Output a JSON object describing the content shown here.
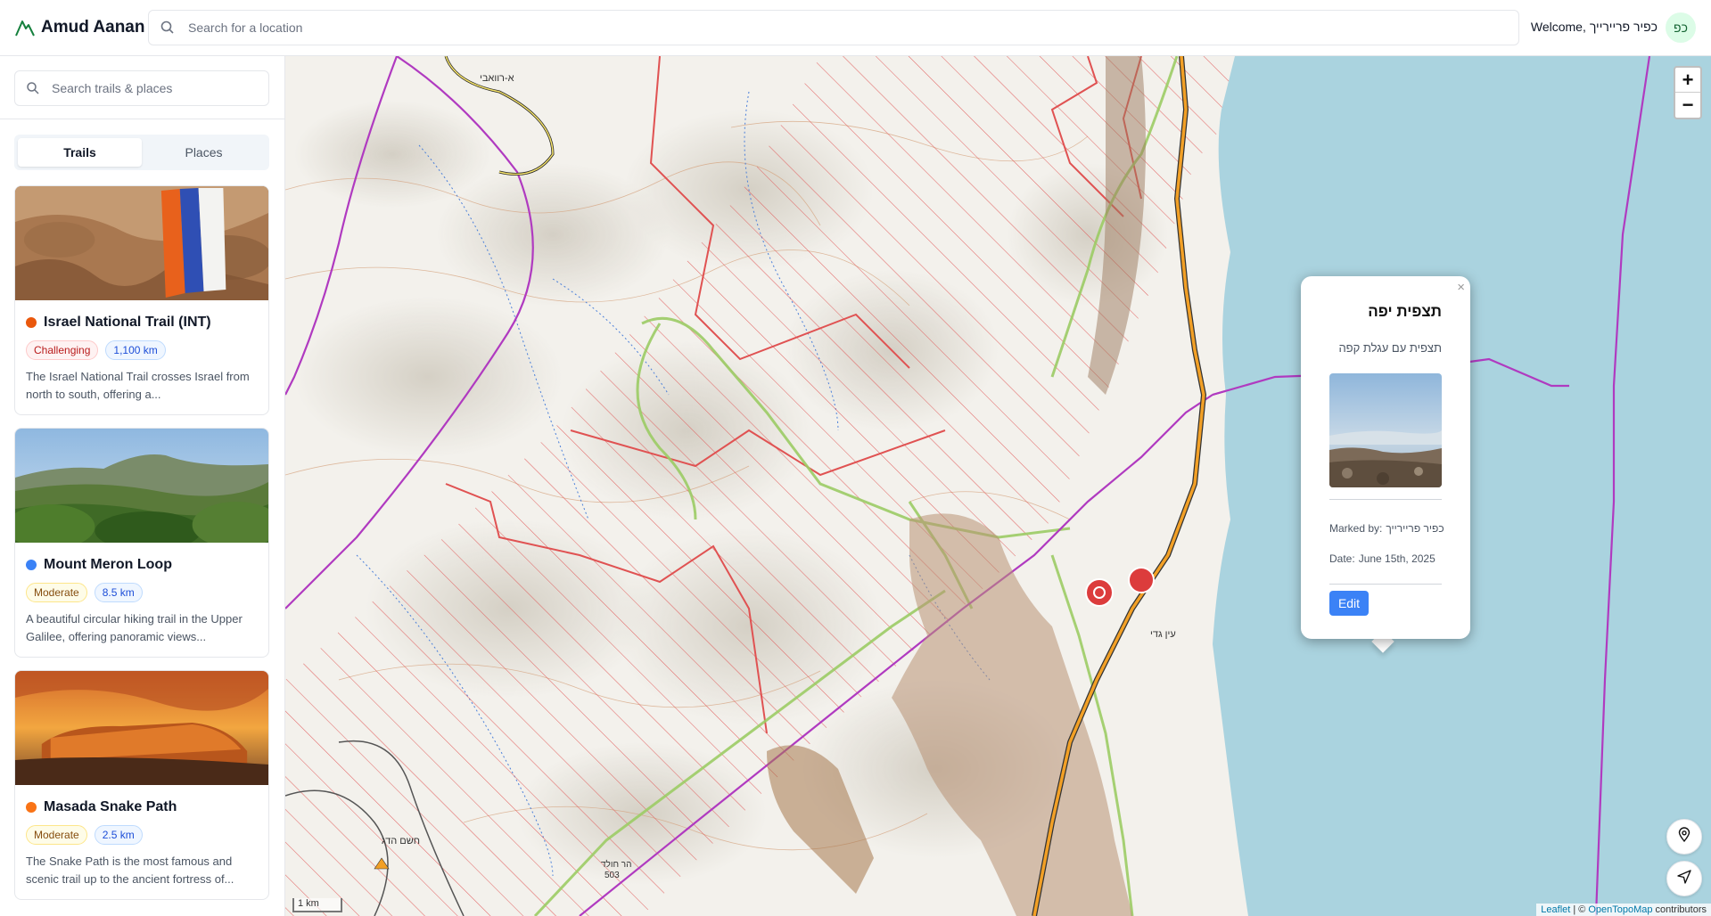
{
  "header": {
    "app_title": "Amud Aanan",
    "location_search_placeholder": "Search for a location",
    "welcome_prefix": "Welcome,",
    "user_name": "כפיר פריירייך",
    "avatar_initials": "כפ"
  },
  "sidebar": {
    "search_placeholder": "Search trails & places",
    "tabs": [
      {
        "label": "Trails",
        "active": true
      },
      {
        "label": "Places",
        "active": false
      }
    ],
    "trails": [
      {
        "title": "Israel National Trail (INT)",
        "dot_color": "#ea580c",
        "difficulty": "Challenging",
        "distance": "1,100 km",
        "description": "The Israel National Trail crosses Israel from north to south, offering a..."
      },
      {
        "title": "Mount Meron Loop",
        "dot_color": "#3b82f6",
        "difficulty": "Moderate",
        "distance": "8.5 km",
        "description": "A beautiful circular hiking trail in the Upper Galilee, offering panoramic views..."
      },
      {
        "title": "Masada Snake Path",
        "dot_color": "#f97316",
        "difficulty": "Moderate",
        "distance": "2.5 km",
        "description": "The Snake Path is the most famous and scenic trail up to the ancient fortress of..."
      }
    ]
  },
  "map": {
    "zoom_in_label": "+",
    "zoom_out_label": "−",
    "scale_label": "1 km",
    "attribution": {
      "leaflet": "Leaflet",
      "separator": "| ©",
      "opentopomap": "OpenTopoMap",
      "suffix": "contributors"
    },
    "labels": {
      "road_label_1": "א-רוואבי",
      "place_label_1": "עין גדי",
      "place_label_2": "חשם הדג",
      "peak_label": "הר חולד",
      "peak_elevation": "503"
    },
    "popup": {
      "title": "תצפית יפה",
      "subtitle": "תצפית עם עגלת קפה",
      "marked_by_label": "Marked by:",
      "marked_by_value": "כפיר פריירייך",
      "date_label": "Date:",
      "date_value": "June 15th, 2025",
      "edit_label": "Edit",
      "close_label": "×"
    },
    "colors": {
      "sea": "#aad3df",
      "restricted_hatch": "#e05252",
      "trail_green": "#9ccc65",
      "border_purple": "#b03ac0",
      "road_orange": "#f2a026",
      "marker_red": "#dc3c3c"
    }
  }
}
